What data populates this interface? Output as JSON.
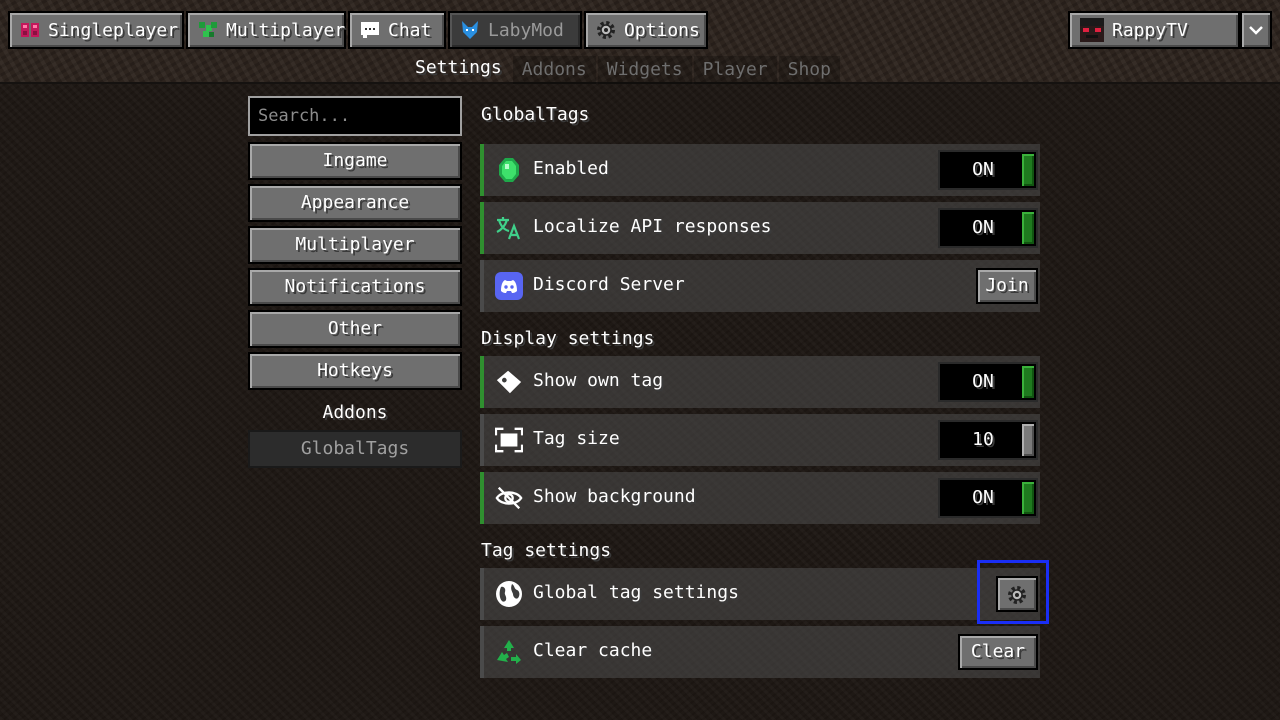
{
  "menu": {
    "singleplayer": "Singleplayer",
    "multiplayer": "Multiplayer",
    "chat": "Chat",
    "labymod": "LabyMod",
    "options": "Options",
    "account": "RappyTV"
  },
  "subtabs": [
    "Settings",
    "Addons",
    "Widgets",
    "Player",
    "Shop"
  ],
  "sidebar": {
    "search_placeholder": "Search...",
    "items": [
      "Ingame",
      "Appearance",
      "Multiplayer",
      "Notifications",
      "Other",
      "Hotkeys"
    ],
    "addons_label": "Addons",
    "addon_items": [
      "GlobalTags"
    ]
  },
  "main": {
    "title": "GlobalTags",
    "rows1": [
      {
        "label": "Enabled",
        "value": "ON"
      },
      {
        "label": "Localize API responses",
        "value": "ON"
      },
      {
        "label": "Discord Server",
        "button": "Join"
      }
    ],
    "display_title": "Display settings",
    "rows2": [
      {
        "label": "Show own tag",
        "value": "ON"
      },
      {
        "label": "Tag size",
        "value": "10"
      },
      {
        "label": "Show background",
        "value": "ON"
      }
    ],
    "tag_title": "Tag settings",
    "rows3": [
      {
        "label": "Global tag settings"
      },
      {
        "label": "Clear cache",
        "button": "Clear"
      }
    ]
  },
  "colors": {
    "toggle_on": "#1f7a1f",
    "highlight": "#1a2ef5",
    "discord": "#5865f2"
  }
}
